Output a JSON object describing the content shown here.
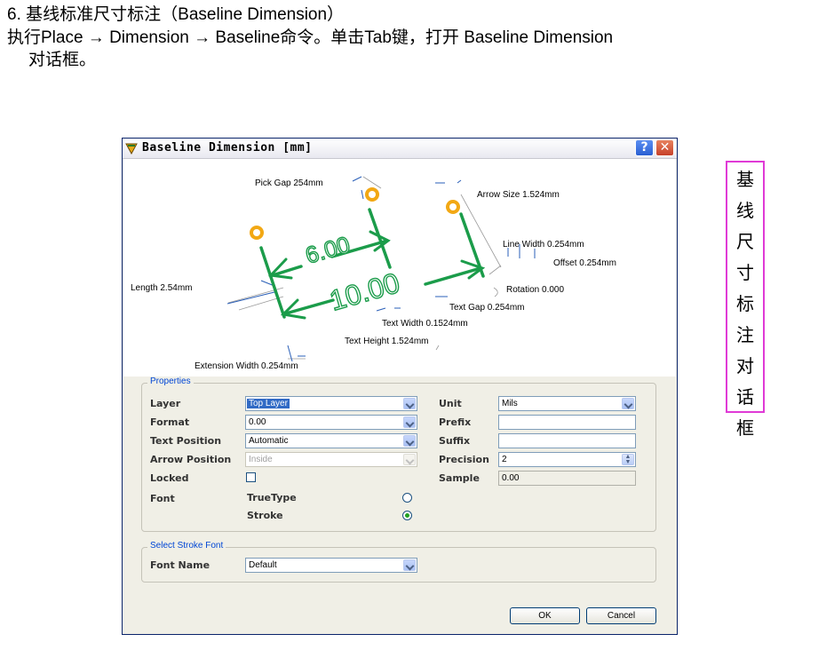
{
  "doc": {
    "heading_num": "6.",
    "heading_text": "基线标准尺寸标注（Baseline Dimension）",
    "instruction_line1": "执行Place → Dimension → Baseline命令。单击Tab键，打开  Baseline Dimension",
    "instruction_line2": "对话框。",
    "side_note": [
      "基",
      "线",
      "尺",
      "寸",
      "标",
      "注",
      "对",
      "话",
      "框"
    ]
  },
  "dialog": {
    "title": "Baseline Dimension [mm]",
    "help_label": "?",
    "close_label": "✕",
    "diagram": {
      "value_small": "6.00",
      "value_large": "10.00",
      "labels": {
        "pick_gap": "Pick Gap  254mm",
        "arrow_size": "Arrow Size  1.524mm",
        "line_width": "Line Width  0.254mm",
        "offset": "Offset  0.254mm",
        "rotation": "Rotation  0.000",
        "length": "Length  2.54mm",
        "text_gap": "Text Gap  0.254mm",
        "text_width": "Text Width  0.1524mm",
        "text_height": "Text Height  1.524mm",
        "extension_width": "Extension Width  0.254mm"
      }
    },
    "properties": {
      "group_title": "Properties",
      "layer_label": "Layer",
      "layer_value": "Top Layer",
      "format_label": "Format",
      "format_value": "0.00",
      "text_position_label": "Text Position",
      "text_position_value": "Automatic",
      "arrow_position_label": "Arrow Position",
      "arrow_position_value": "Inside",
      "locked_label": "Locked",
      "font_label": "Font",
      "font_truetype": "TrueType",
      "font_stroke": "Stroke",
      "unit_label": "Unit",
      "unit_value": "Mils",
      "prefix_label": "Prefix",
      "prefix_value": "",
      "suffix_label": "Suffix",
      "suffix_value": "",
      "precision_label": "Precision",
      "precision_value": "2",
      "sample_label": "Sample",
      "sample_value": "0.00"
    },
    "stroke_font": {
      "group_title": "Select Stroke Font",
      "font_name_label": "Font Name",
      "font_name_value": "Default"
    },
    "ok_label": "OK",
    "cancel_label": "Cancel"
  },
  "colors": {
    "accent_green": "#1b9c4a",
    "pad_orange": "#f2a814",
    "side_border": "#e03ad6",
    "selection": "#316ac5"
  }
}
